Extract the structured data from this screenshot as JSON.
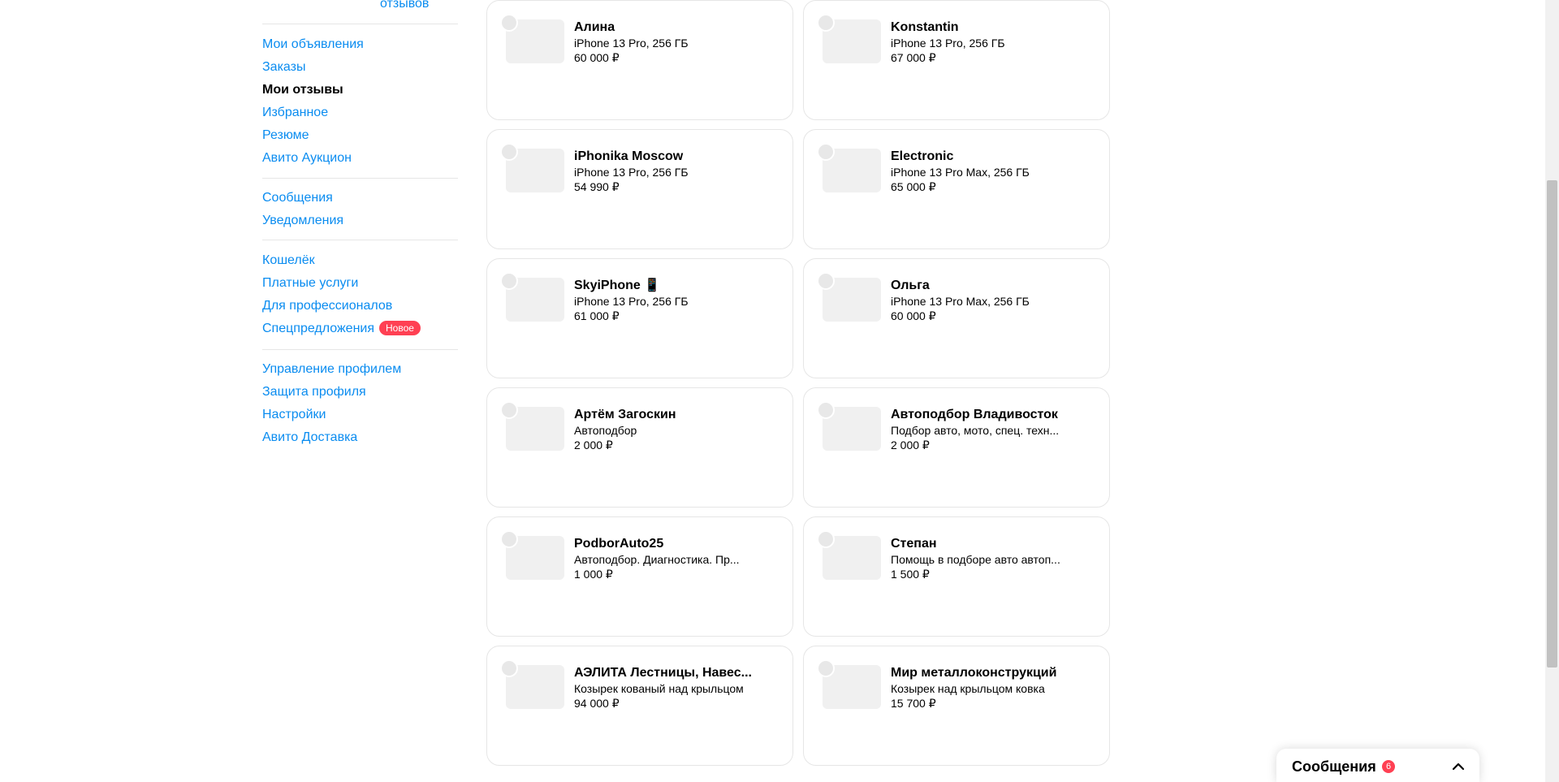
{
  "header": {
    "reviews_link_partial": "отзывов"
  },
  "sidebar": {
    "group1": [
      "Мои объявления",
      "Заказы",
      "Мои отзывы",
      "Избранное",
      "Резюме",
      "Авито Аукцион"
    ],
    "group2": [
      "Сообщения",
      "Уведомления"
    ],
    "group3": [
      "Кошелёк",
      "Платные услуги",
      "Для профессионалов",
      "Спецпредложения"
    ],
    "badge_new": "Новое",
    "group4": [
      "Управление профилем",
      "Защита профиля",
      "Настройки",
      "Авито Доставка"
    ]
  },
  "cards": [
    {
      "name": "Алина",
      "item": "iPhone 13 Pro, 256 ГБ",
      "price": "60 000 ₽"
    },
    {
      "name": "Konstantin",
      "item": "iPhone 13 Pro, 256 ГБ",
      "price": "67 000 ₽"
    },
    {
      "name": "iPhonika Moscow",
      "item": "iPhone 13 Pro, 256 ГБ",
      "price": "54 990 ₽"
    },
    {
      "name": "Electronic",
      "item": "iPhone 13 Pro Max, 256 ГБ",
      "price": "65 000 ₽"
    },
    {
      "name": "SkyiPhone 📱",
      "item": "iPhone 13 Pro, 256 ГБ",
      "price": "61 000 ₽"
    },
    {
      "name": "Ольга",
      "item": "iPhone 13 Pro Max, 256 ГБ",
      "price": "60 000 ₽"
    },
    {
      "name": "Артём Загоскин",
      "item": "Автоподбор",
      "price": "2 000 ₽"
    },
    {
      "name": "Автоподбор Владивосток",
      "item": "Подбор авто, мото, спец. техн...",
      "price": "2 000 ₽"
    },
    {
      "name": "PodborAuto25",
      "item": "Автоподбор. Диагностика. Пр...",
      "price": "1 000 ₽"
    },
    {
      "name": "Степан",
      "item": "Помощь в подборе авто автоп...",
      "price": "1 500 ₽"
    },
    {
      "name": "АЭЛИТА Лестницы, Навес...",
      "item": "Козырек кованый над крыльцом",
      "price": "94 000 ₽"
    },
    {
      "name": "Мир металлоконструкций",
      "item": "Козырек над крыльцом ковка",
      "price": "15 700 ₽"
    }
  ],
  "messages_widget": {
    "label": "Сообщения",
    "count": "6"
  },
  "colors": {
    "link": "#0a8cf0",
    "badge": "#ff4053",
    "border": "#e6e6e6"
  }
}
